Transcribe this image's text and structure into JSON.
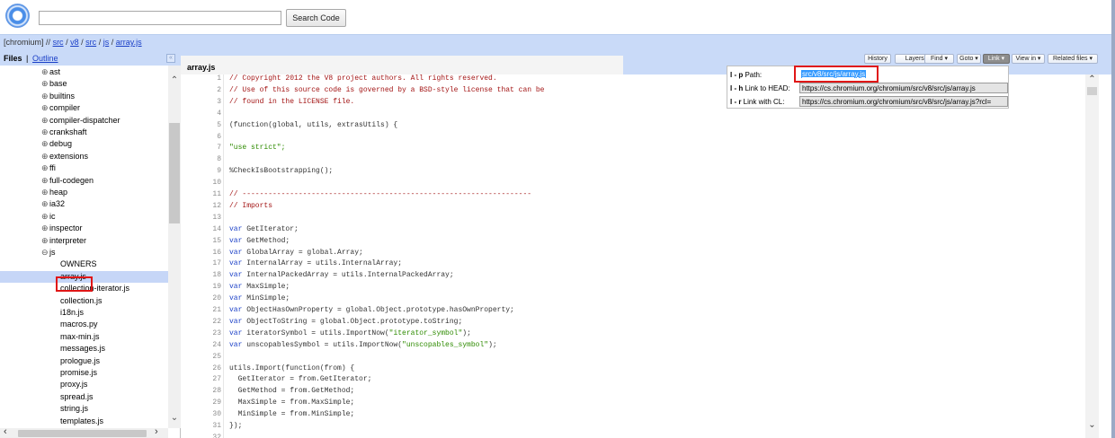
{
  "search": {
    "placeholder": "",
    "button_label": "Search Code"
  },
  "breadcrumb": {
    "root": "[chromium]",
    "sep1": "//",
    "parts": [
      "src",
      "v8",
      "src",
      "js",
      "array.js"
    ],
    "slash": "/"
  },
  "left_panel": {
    "files_label": "Files",
    "divider": "|",
    "outline_label": "Outline",
    "collapse_glyph": "«",
    "tree_items": [
      {
        "label": "ast",
        "expander": "⊕",
        "indent": 1
      },
      {
        "label": "base",
        "expander": "⊕",
        "indent": 1
      },
      {
        "label": "builtins",
        "expander": "⊕",
        "indent": 1
      },
      {
        "label": "compiler",
        "expander": "⊕",
        "indent": 1
      },
      {
        "label": "compiler-dispatcher",
        "expander": "⊕",
        "indent": 1
      },
      {
        "label": "crankshaft",
        "expander": "⊕",
        "indent": 1
      },
      {
        "label": "debug",
        "expander": "⊕",
        "indent": 1
      },
      {
        "label": "extensions",
        "expander": "⊕",
        "indent": 1
      },
      {
        "label": "ffi",
        "expander": "⊕",
        "indent": 1
      },
      {
        "label": "full-codegen",
        "expander": "⊕",
        "indent": 1
      },
      {
        "label": "heap",
        "expander": "⊕",
        "indent": 1
      },
      {
        "label": "ia32",
        "expander": "⊕",
        "indent": 1
      },
      {
        "label": "ic",
        "expander": "⊕",
        "indent": 1
      },
      {
        "label": "inspector",
        "expander": "⊕",
        "indent": 1
      },
      {
        "label": "interpreter",
        "expander": "⊕",
        "indent": 1
      },
      {
        "label": "js",
        "expander": "⊖",
        "indent": 1
      },
      {
        "label": "OWNERS",
        "expander": "",
        "indent": 2
      },
      {
        "label": "array.js",
        "expander": "",
        "indent": 2,
        "selected": true
      },
      {
        "label": "collection-iterator.js",
        "expander": "",
        "indent": 2
      },
      {
        "label": "collection.js",
        "expander": "",
        "indent": 2
      },
      {
        "label": "i18n.js",
        "expander": "",
        "indent": 2
      },
      {
        "label": "macros.py",
        "expander": "",
        "indent": 2
      },
      {
        "label": "max-min.js",
        "expander": "",
        "indent": 2
      },
      {
        "label": "messages.js",
        "expander": "",
        "indent": 2
      },
      {
        "label": "prologue.js",
        "expander": "",
        "indent": 2
      },
      {
        "label": "promise.js",
        "expander": "",
        "indent": 2
      },
      {
        "label": "proxy.js",
        "expander": "",
        "indent": 2
      },
      {
        "label": "spread.js",
        "expander": "",
        "indent": 2
      },
      {
        "label": "string.js",
        "expander": "",
        "indent": 2
      },
      {
        "label": "templates.js",
        "expander": "",
        "indent": 2
      }
    ]
  },
  "code_pane": {
    "file_title": "array.js",
    "toolbar": [
      {
        "label": "History",
        "active": false
      },
      {
        "label": "Layers ▾",
        "active": false
      },
      {
        "label": "Find ▾",
        "active": false
      },
      {
        "label": "Goto ▾",
        "active": false
      },
      {
        "label": "Link ▾",
        "active": true
      },
      {
        "label": "View in ▾",
        "active": false
      },
      {
        "label": "Related files ▾",
        "active": false
      }
    ],
    "lines": [
      {
        "n": "1",
        "t": "// Copyright 2012 the V8 project authors. All rights reserved.",
        "k": "com"
      },
      {
        "n": "2",
        "t": "// Use of this source code is governed by a BSD-style license that can be",
        "k": "com"
      },
      {
        "n": "3",
        "t": "// found in the LICENSE file.",
        "k": "com"
      },
      {
        "n": "4",
        "t": "",
        "k": "plain"
      },
      {
        "n": "5",
        "t": "(function(global, utils, extrasUtils) {",
        "k": "plain"
      },
      {
        "n": "6",
        "t": "",
        "k": "plain"
      },
      {
        "n": "7",
        "t": "\"use strict\";",
        "k": "str"
      },
      {
        "n": "8",
        "t": "",
        "k": "plain"
      },
      {
        "n": "9",
        "t": "%CheckIsBootstrapping();",
        "k": "plain"
      },
      {
        "n": "10",
        "t": "",
        "k": "plain"
      },
      {
        "n": "11",
        "t": "// -------------------------------------------------------------------",
        "k": "com"
      },
      {
        "n": "12",
        "t": "// Imports",
        "k": "com"
      },
      {
        "n": "13",
        "t": "",
        "k": "plain"
      },
      {
        "n": "14",
        "t": "var GetIterator;",
        "k": "var"
      },
      {
        "n": "15",
        "t": "var GetMethod;",
        "k": "var"
      },
      {
        "n": "16",
        "t": "var GlobalArray = global.Array;",
        "k": "var"
      },
      {
        "n": "17",
        "t": "var InternalArray = utils.InternalArray;",
        "k": "var"
      },
      {
        "n": "18",
        "t": "var InternalPackedArray = utils.InternalPackedArray;",
        "k": "var"
      },
      {
        "n": "19",
        "t": "var MaxSimple;",
        "k": "var"
      },
      {
        "n": "20",
        "t": "var MinSimple;",
        "k": "var"
      },
      {
        "n": "21",
        "t": "var ObjectHasOwnProperty = global.Object.prototype.hasOwnProperty;",
        "k": "var"
      },
      {
        "n": "22",
        "t": "var ObjectToString = global.Object.prototype.toString;",
        "k": "var"
      },
      {
        "n": "23",
        "t": "var iteratorSymbol = utils.ImportNow(\"iterator_symbol\");",
        "k": "var"
      },
      {
        "n": "24",
        "t": "var unscopablesSymbol = utils.ImportNow(\"unscopables_symbol\");",
        "k": "var"
      },
      {
        "n": "25",
        "t": "",
        "k": "plain"
      },
      {
        "n": "26",
        "t": "utils.Import(function(from) {",
        "k": "plain"
      },
      {
        "n": "27",
        "t": "  GetIterator = from.GetIterator;",
        "k": "plain"
      },
      {
        "n": "28",
        "t": "  GetMethod = from.GetMethod;",
        "k": "plain"
      },
      {
        "n": "29",
        "t": "  MaxSimple = from.MaxSimple;",
        "k": "plain"
      },
      {
        "n": "30",
        "t": "  MinSimple = from.MinSimple;",
        "k": "plain"
      },
      {
        "n": "31",
        "t": "});",
        "k": "plain"
      },
      {
        "n": "32",
        "t": "",
        "k": "plain"
      }
    ]
  },
  "link_panel": {
    "rows": [
      {
        "key": "l - p",
        "label": " Path:",
        "value": "src/v8/src/js/array.js",
        "selected": true
      },
      {
        "key": "l - h",
        "label": " Link to HEAD:",
        "value": "https://cs.chromium.org/chromium/src/v8/src/js/array.js",
        "selected": false
      },
      {
        "key": "l - r",
        "label": " Link with CL:",
        "value": "https://cs.chromium.org/chromium/src/v8/src/js/array.js?rcl=",
        "selected": false
      }
    ]
  },
  "colors": {
    "header_band": "#c9daf8",
    "highlight_box": "#e01616",
    "selection": "#3399ff",
    "comment": "#a31515",
    "keyword": "#1a3fc7",
    "string": "#2e8b00"
  }
}
